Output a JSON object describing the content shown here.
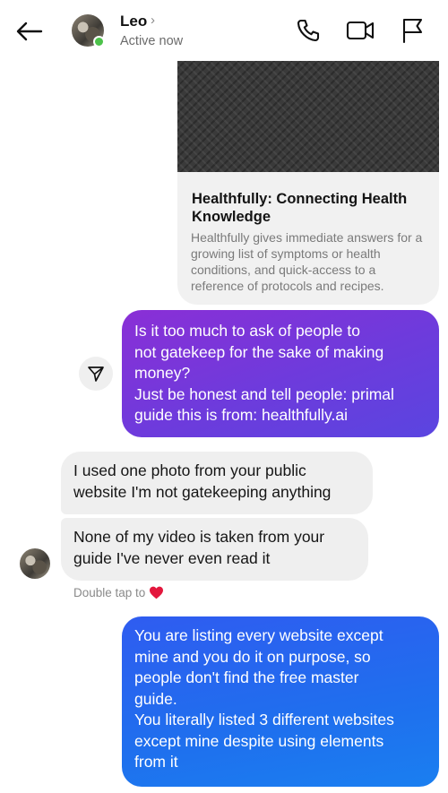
{
  "header": {
    "contact_name": "Leo",
    "status": "Active now",
    "chevron": "›",
    "back_icon": "arrow-left-icon",
    "call_icon": "phone-icon",
    "video_icon": "video-camera-icon",
    "report_icon": "flag-icon",
    "online_color": "#4cc24a"
  },
  "link_preview": {
    "title": "Healthfully: Connecting Health Knowledge",
    "description": "Healthfully gives immediate answers for a growing list of symptoms or health conditions, and quick-access to a reference of protocols and recipes."
  },
  "messages": [
    {
      "direction": "outgoing",
      "lines": [
        "Is it too much to ask of people to",
        "not gatekeep for the sake of making",
        "money?",
        "Just be honest and tell people: primal",
        "guide this is from: healthfully.ai"
      ],
      "color": "#7b35d9"
    },
    {
      "direction": "incoming",
      "lines": [
        "I used one photo from your public",
        "website I'm not gatekeeping anything"
      ]
    },
    {
      "direction": "incoming",
      "lines": [
        "None of my video is taken from your",
        "guide I've never even read it"
      ]
    },
    {
      "direction": "outgoing",
      "lines": [
        "You are listing every website except",
        "mine and you do it on purpose, so",
        "people don't find the free master",
        "guide.",
        "You literally listed 3 different websites",
        "except mine despite using elements",
        "from it"
      ],
      "color": "#2b66f0"
    }
  ],
  "reaction_hint": {
    "text": "Double tap to",
    "icon": "heart-icon",
    "heart_color": "#e3173d"
  }
}
